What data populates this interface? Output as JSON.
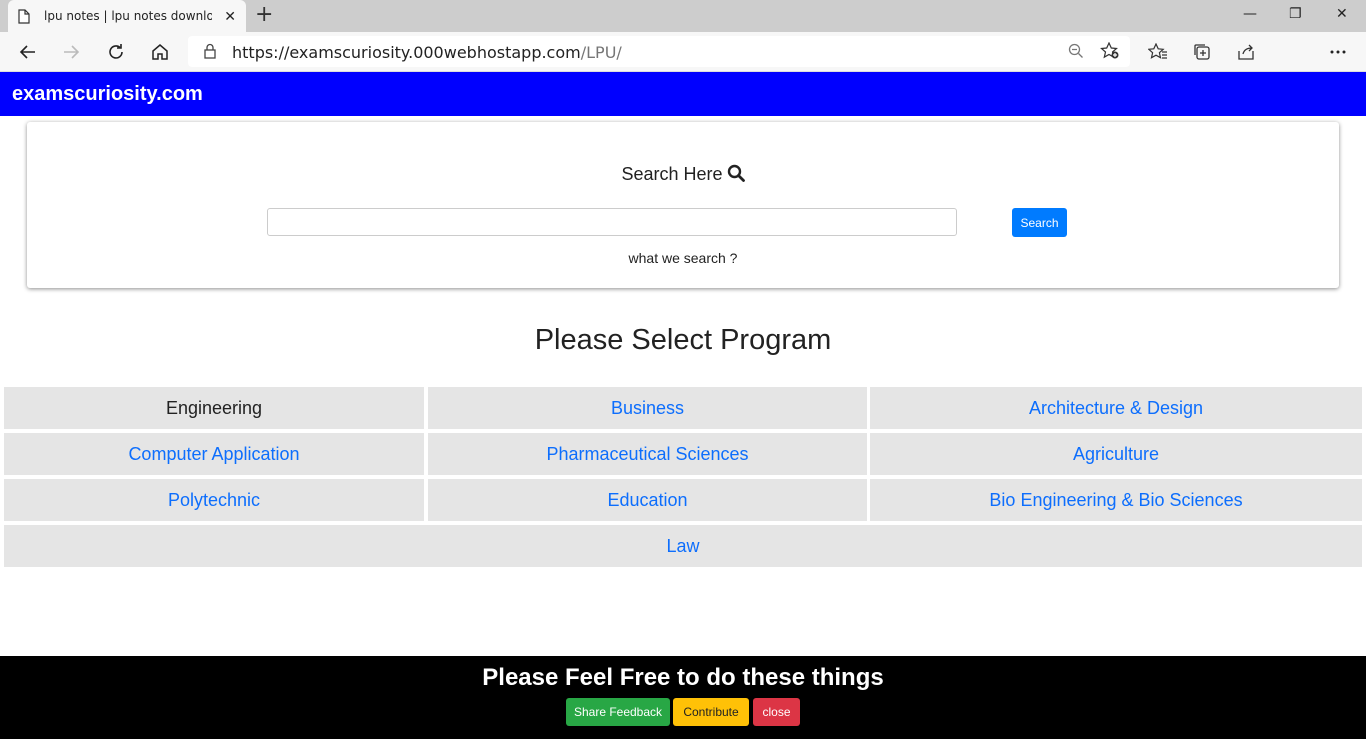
{
  "browser": {
    "tab_title": "lpu notes | lpu notes download |",
    "tab_close": "✕",
    "new_tab": "+",
    "url_host": "https://examscuriosity.000webhostapp.com",
    "url_path": "/LPU/",
    "window_controls": {
      "minimize": "—",
      "restore": "❐",
      "close": "✕"
    }
  },
  "site": {
    "brand": "examscuriosity.com"
  },
  "search": {
    "heading": "Search Here",
    "input_value": "",
    "placeholder": "",
    "button_label": "Search",
    "hint": "what we search ?"
  },
  "programs": {
    "title": "Please Select Program",
    "items": [
      {
        "label": "Engineering",
        "active": true
      },
      {
        "label": "Business",
        "active": false
      },
      {
        "label": "Architecture & Design",
        "active": false
      },
      {
        "label": "Computer Application",
        "active": false
      },
      {
        "label": "Pharmaceutical Sciences",
        "active": false
      },
      {
        "label": "Agriculture",
        "active": false
      },
      {
        "label": "Polytechnic",
        "active": false
      },
      {
        "label": "Education",
        "active": false
      },
      {
        "label": "Bio Engineering & Bio Sciences",
        "active": false
      },
      {
        "label": "Law",
        "active": false
      }
    ]
  },
  "footer": {
    "message": "Please Feel Free to do these things",
    "share_label": "Share Feedback",
    "contribute_label": "Contribute",
    "close_label": "close"
  },
  "colors": {
    "brand_bar": "#0000ff",
    "link": "#0d6efd",
    "primary_button": "#007bff",
    "success": "#28a745",
    "warning": "#ffc107",
    "danger": "#dc3545"
  }
}
